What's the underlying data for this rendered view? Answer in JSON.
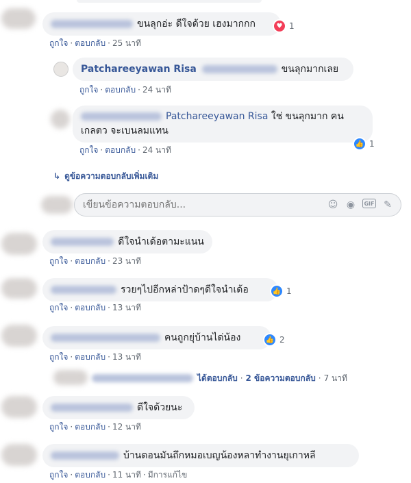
{
  "actions": {
    "like": "ถูกใจ",
    "reply": "ตอบกลับ",
    "sep": "·"
  },
  "comments": [
    {
      "text": "ขนลุกอ่ะ ดีใจด้วย เฮงมากกก",
      "time": "25 นาที",
      "reaction_count": "1",
      "reaction": "love"
    },
    {
      "author": "Patchareeyawan Risa",
      "text": "ขนลุกมากเลย",
      "time": "24 นาที"
    },
    {
      "author": "Patchareeyawan Risa",
      "text": "ใช่ ขนลุกมาก คน",
      "text2": "เกลตว จะเบนลมแทน",
      "time": "24 นาที",
      "reaction_count": "1",
      "reaction": "like"
    },
    {
      "text": "ดีใจนำเด้อตามะแนน",
      "time": "23 นาที"
    },
    {
      "text": "รวยๆไปอีกหล่าป้าดๆดีใจนำเด้อ",
      "time": "13 นาที",
      "reaction_count": "1",
      "reaction": "like"
    },
    {
      "text": "คนถูกยุ่บ้านได่น้อง",
      "time": "13 นาที",
      "reaction_count": "2",
      "reaction": "like"
    },
    {
      "text": "ดีใจด้วยนะ",
      "time": "12 นาที"
    },
    {
      "text": "บ้านดอนมันถึกหมอเบญน้องหลาทำงานยุเกาหลี",
      "time": "11 นาที",
      "edited": "มีการแก้ไข"
    }
  ],
  "more_replies": "ดูข้อความตอบกลับเพิ่มเติม",
  "reply_box": {
    "placeholder": "เขียนข้อความตอบกลับ..."
  },
  "reply_summary": {
    "replied": "ได้ตอบกลับ",
    "count": "2 ข้อความตอบกลับ",
    "time": "7 นาที"
  },
  "icons": {
    "emoji": "☺",
    "camera": "◉",
    "gif": "GIF",
    "sticker": "✎",
    "like": "👍",
    "love": "♥",
    "arrow": "↳"
  }
}
